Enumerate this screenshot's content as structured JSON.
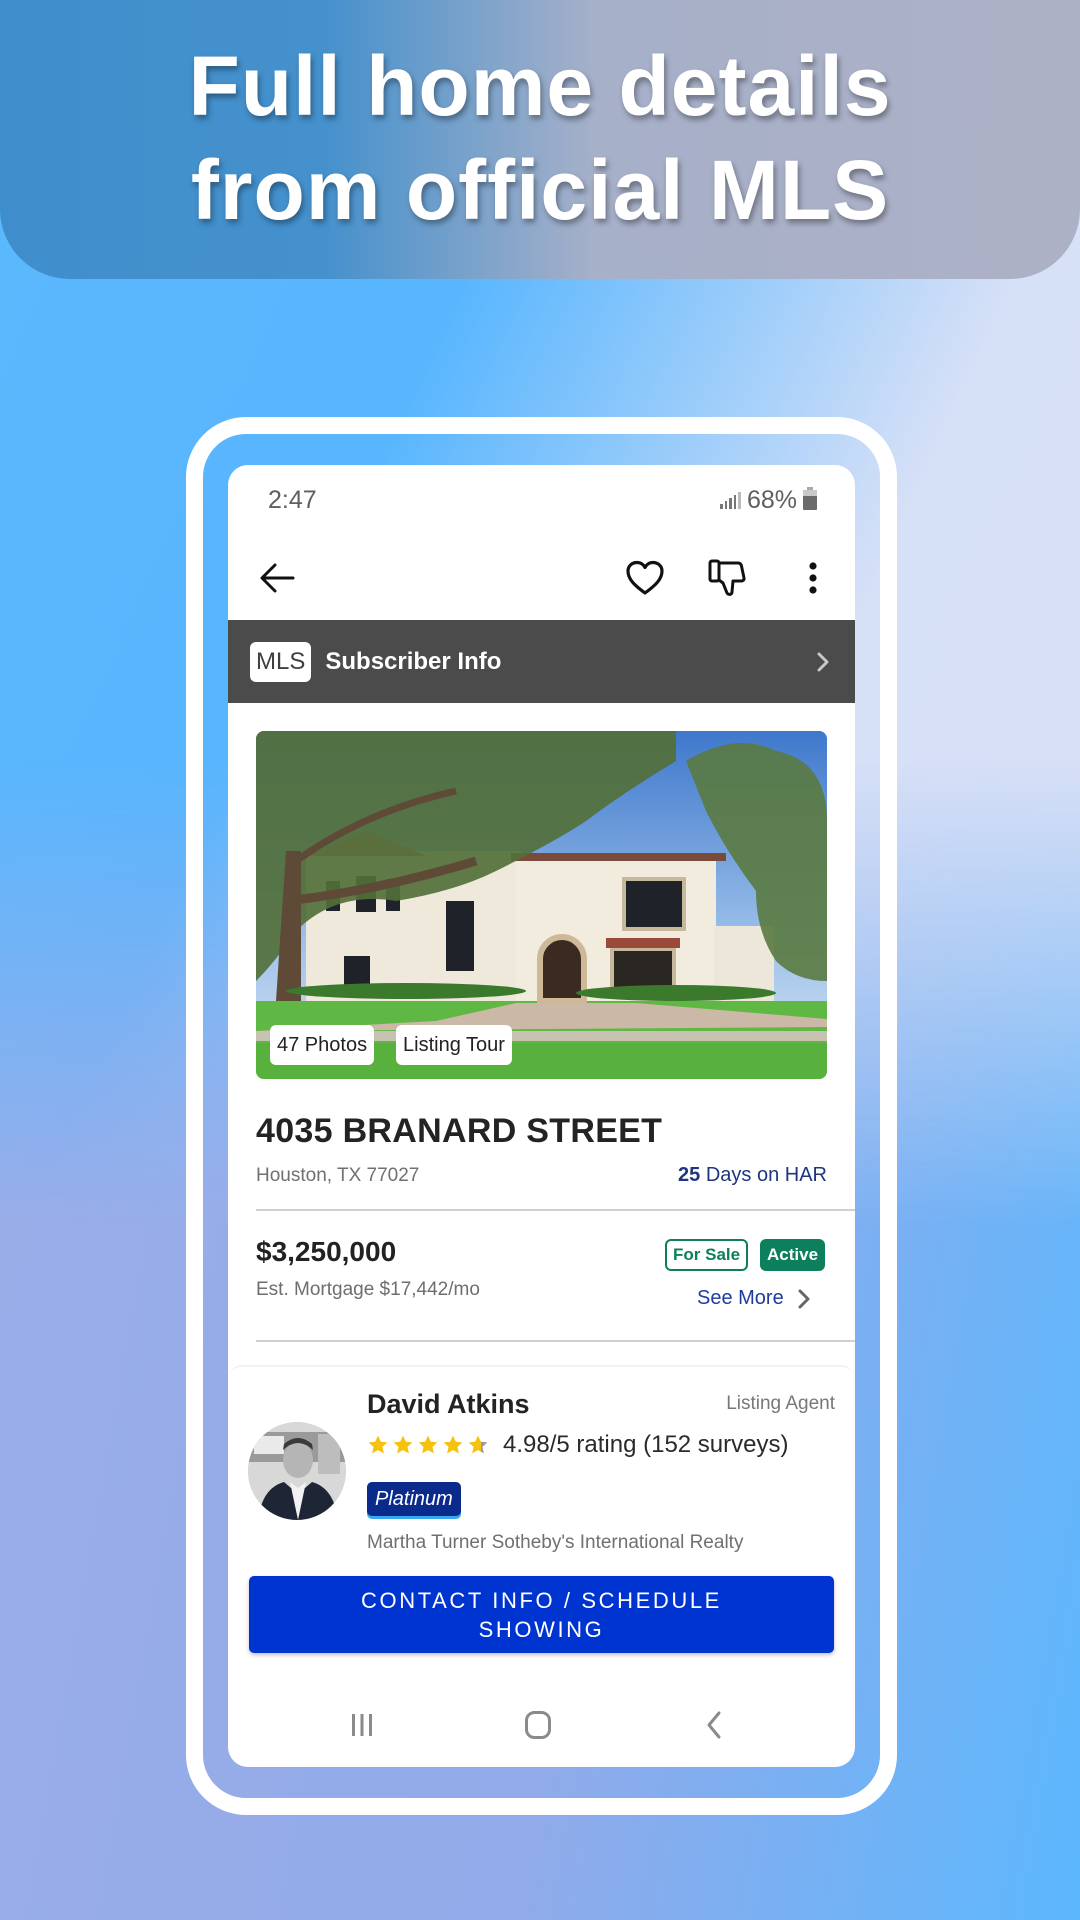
{
  "banner": {
    "headline_line1": "Full home details",
    "headline_line2": "from official MLS"
  },
  "status_bar": {
    "time": "2:47",
    "battery_percent": "68%",
    "icons": [
      "signal-icon",
      "battery-icon"
    ]
  },
  "toolbar": {
    "icons": [
      "back-arrow-icon",
      "heart-icon",
      "thumbs-down-icon",
      "more-vertical-icon"
    ]
  },
  "mls_bar": {
    "badge": "MLS",
    "label": "Subscriber Info",
    "icon": "chevron-right-icon"
  },
  "listing": {
    "photo_count_label": "47 Photos",
    "tour_label": "Listing Tour",
    "address": "4035 BRANARD STREET",
    "city_state_zip": "Houston, TX 77027",
    "days_count": "25",
    "days_label": "Days on HAR",
    "price": "$3,250,000",
    "mortgage": "Est. Mortgage $17,442/mo",
    "status_badges": [
      "For Sale",
      "Active"
    ],
    "see_more": "See More",
    "colors": {
      "status_green": "#0d7f5c",
      "link_blue": "#1f3c9e"
    }
  },
  "agent": {
    "name": "David Atkins",
    "role": "Listing Agent",
    "rating_value": 4.98,
    "rating_max": 5,
    "rating_text": "4.98/5 rating (152 surveys)",
    "tier": "Platinum",
    "brokerage": "Martha Turner Sotheby's International Realty"
  },
  "cta": {
    "label": "CONTACT INFO / SCHEDULE SHOWING",
    "color": "#0034d1"
  },
  "nav_bar": {
    "icons": [
      "recent-apps-icon",
      "home-icon",
      "back-icon"
    ]
  }
}
